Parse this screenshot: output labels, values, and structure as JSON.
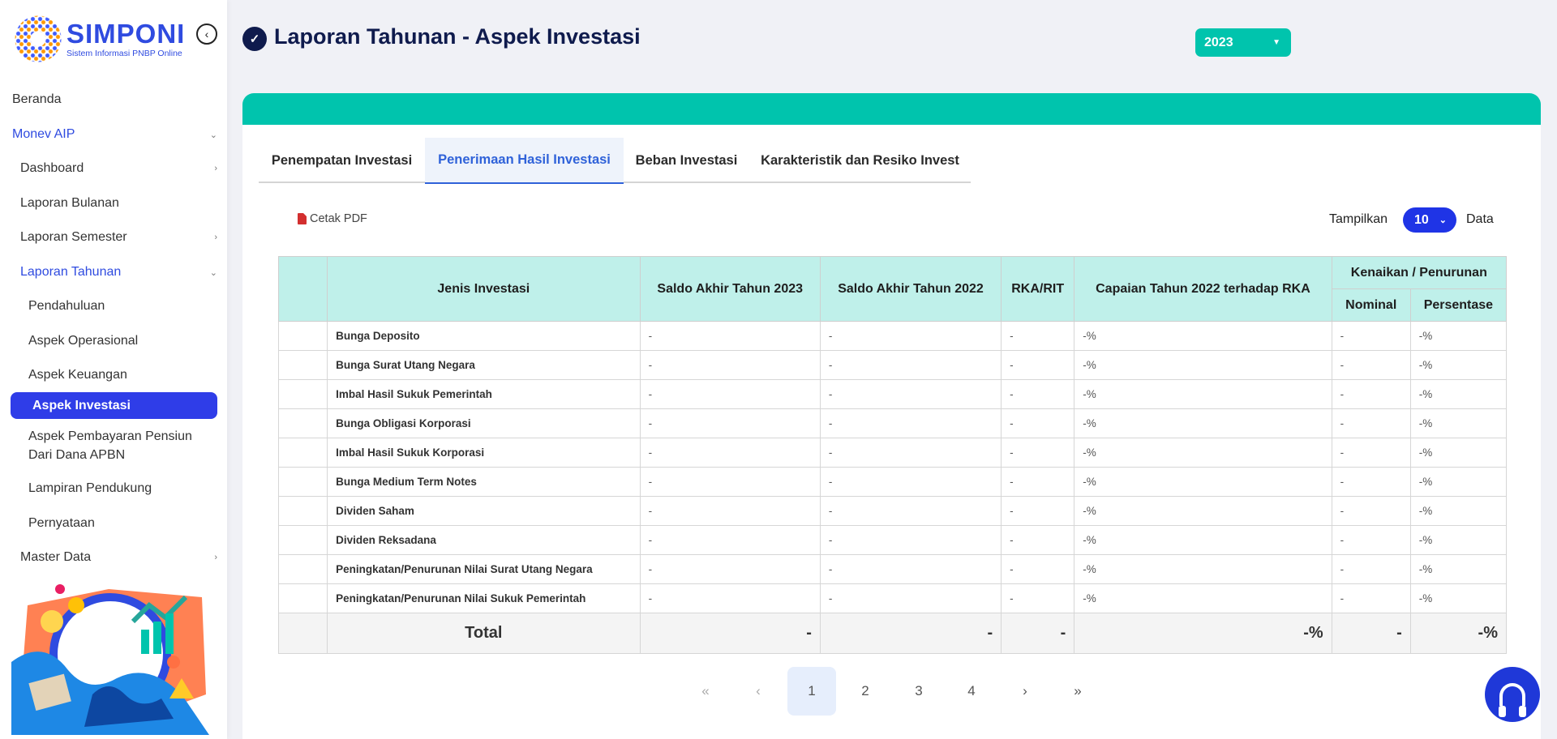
{
  "brand": {
    "title": "SIMPONI",
    "subtitle": "Sistem Informasi PNBP Online"
  },
  "sidebar": {
    "items": [
      {
        "label": "Beranda"
      },
      {
        "label": "Monev AIP"
      },
      {
        "label": "Dashboard"
      },
      {
        "label": "Laporan Bulanan"
      },
      {
        "label": "Laporan Semester"
      },
      {
        "label": "Laporan Tahunan"
      },
      {
        "label": "Pendahuluan"
      },
      {
        "label": "Aspek Operasional"
      },
      {
        "label": "Aspek Keuangan"
      },
      {
        "label": "Aspek Investasi"
      },
      {
        "label": "Aspek Pembayaran Pensiun Dari Dana APBN"
      },
      {
        "label": "Lampiran Pendukung"
      },
      {
        "label": "Pernyataan"
      },
      {
        "label": "Master Data"
      }
    ]
  },
  "header": {
    "title": "Laporan Tahunan - Aspek Investasi",
    "year": "2023"
  },
  "tabs": [
    {
      "label": "Penempatan Investasi"
    },
    {
      "label": "Penerimaan Hasil Investasi"
    },
    {
      "label": "Beban Investasi"
    },
    {
      "label": "Karakteristik dan Resiko Invest"
    }
  ],
  "toolbar": {
    "cetak_label": "Cetak PDF",
    "tampilkan_label": "Tampilkan",
    "page_size": "10",
    "data_label": "Data"
  },
  "table": {
    "headers": {
      "jenis": "Jenis Investasi",
      "saldo2023": "Saldo Akhir Tahun 2023",
      "saldo2022": "Saldo Akhir Tahun 2022",
      "rka": "RKA/RIT",
      "capaian": "Capaian Tahun 2022 terhadap RKA",
      "kenaikan": "Kenaikan / Penurunan",
      "nominal": "Nominal",
      "persentase": "Persentase"
    },
    "rows": [
      {
        "label": "Bunga Deposito",
        "saldo2023": "-",
        "saldo2022": "-",
        "rka": "-",
        "capaian": "-%",
        "nominal": "-",
        "persentase": "-%"
      },
      {
        "label": "Bunga Surat Utang Negara",
        "saldo2023": "-",
        "saldo2022": "-",
        "rka": "-",
        "capaian": "-%",
        "nominal": "-",
        "persentase": "-%"
      },
      {
        "label": "Imbal Hasil Sukuk Pemerintah",
        "saldo2023": "-",
        "saldo2022": "-",
        "rka": "-",
        "capaian": "-%",
        "nominal": "-",
        "persentase": "-%"
      },
      {
        "label": "Bunga Obligasi Korporasi",
        "saldo2023": "-",
        "saldo2022": "-",
        "rka": "-",
        "capaian": "-%",
        "nominal": "-",
        "persentase": "-%"
      },
      {
        "label": "Imbal Hasil Sukuk Korporasi",
        "saldo2023": "-",
        "saldo2022": "-",
        "rka": "-",
        "capaian": "-%",
        "nominal": "-",
        "persentase": "-%"
      },
      {
        "label": "Bunga Medium Term Notes",
        "saldo2023": "-",
        "saldo2022": "-",
        "rka": "-",
        "capaian": "-%",
        "nominal": "-",
        "persentase": "-%"
      },
      {
        "label": "Dividen Saham",
        "saldo2023": "-",
        "saldo2022": "-",
        "rka": "-",
        "capaian": "-%",
        "nominal": "-",
        "persentase": "-%"
      },
      {
        "label": "Dividen Reksadana",
        "saldo2023": "-",
        "saldo2022": "-",
        "rka": "-",
        "capaian": "-%",
        "nominal": "-",
        "persentase": "-%"
      },
      {
        "label": "Peningkatan/Penurunan Nilai Surat Utang Negara",
        "saldo2023": "-",
        "saldo2022": "-",
        "rka": "-",
        "capaian": "-%",
        "nominal": "-",
        "persentase": "-%"
      },
      {
        "label": "Peningkatan/Penurunan Nilai Sukuk Pemerintah",
        "saldo2023": "-",
        "saldo2022": "-",
        "rka": "-",
        "capaian": "-%",
        "nominal": "-",
        "persentase": "-%"
      }
    ],
    "total": {
      "label": "Total",
      "saldo2023": "-",
      "saldo2022": "-",
      "rka": "-",
      "capaian": "-%",
      "nominal": "-",
      "persentase": "-%"
    }
  },
  "pagination": {
    "first": "«",
    "prev": "‹",
    "pages": [
      "1",
      "2",
      "3",
      "4"
    ],
    "next": "›",
    "last": "»",
    "current": "1"
  },
  "icons": {
    "collapse": "chevron-left-circle-icon",
    "page": "check-circle-icon",
    "pdf": "pdf-file-icon",
    "help": "headset-icon"
  },
  "colors": {
    "primary": "#2f3de8",
    "accent": "#00c4ad",
    "header_bg": "#bff0ea",
    "title": "#0f1b4d"
  }
}
